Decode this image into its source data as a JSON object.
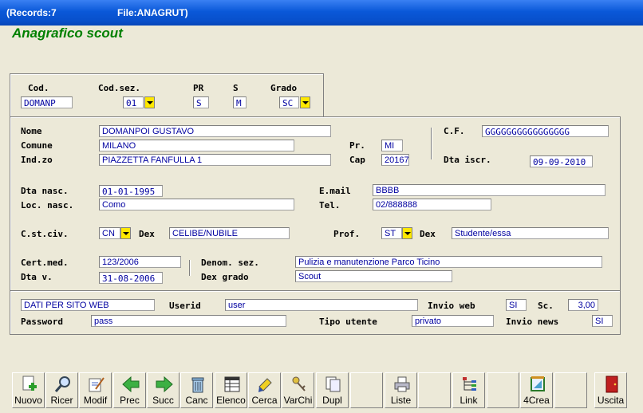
{
  "window": {
    "records": "(Records:7",
    "file": "File:ANAGRUT)"
  },
  "heading": "Anagrafico scout",
  "top": {
    "cod_label": "Cod.",
    "cod": "DOMANP",
    "codsez_label": "Cod.sez.",
    "codsez": "01",
    "pr_label": "PR",
    "pr": "S",
    "s_label": "S",
    "s": "M",
    "grado_label": "Grado",
    "grado": "SC"
  },
  "anag": {
    "nome_label": "Nome",
    "nome": "DOMANPOI GUSTAVO",
    "comune_label": "Comune",
    "comune": "MILANO",
    "indzo_label": "Ind.zo",
    "indzo": "PIAZZETTA FANFULLA 1",
    "pr_label": "Pr.",
    "pr": "MI",
    "cap_label": "Cap",
    "cap": "20167",
    "cf_label": "C.F.",
    "cf": "GGGGGGGGGGGGGGGG",
    "dtaiscr_label": "Dta iscr.",
    "dtaiscr": "09-09-2010",
    "dtanasc_label": "Dta nasc.",
    "dtanasc": "01-01-1995",
    "locnasc_label": "Loc. nasc.",
    "locnasc": "Como",
    "email_label": "E.mail",
    "email": "BBBB",
    "tel_label": "Tel.",
    "tel": "02/888888",
    "cstciv_label": "C.st.civ.",
    "cstciv": "CN",
    "dex1_label": "Dex",
    "dex1": "CELIBE/NUBILE",
    "prof_label": "Prof.",
    "prof": "ST",
    "dex2_label": "Dex",
    "dex2": "Studente/essa",
    "certmed_label": "Cert.med.",
    "certmed": "123/2006",
    "dtav_label": "Dta v.",
    "dtav": "31-08-2006",
    "denomsez_label": "Denom. sez.",
    "denomsez": "Pulizia e manutenzione Parco Ticino",
    "dexgrado_label": "Dex grado",
    "dexgrado": "Scout"
  },
  "web": {
    "title": "DATI PER SITO WEB",
    "userid_label": "Userid",
    "userid": "user",
    "invioweb_label": "Invio web",
    "invioweb": "SI",
    "sc_label": "Sc.",
    "sc": "3,00",
    "password_label": "Password",
    "password": "pass",
    "tipoutente_label": "Tipo utente",
    "tipoutente": "privato",
    "invionews_label": "Invio news",
    "invionews": "SI"
  },
  "toolbar": {
    "nuovo": "Nuovo",
    "ricer": "Ricer",
    "modif": "Modif",
    "prec": "Prec",
    "succ": "Succ",
    "canc": "Canc",
    "elenco": "Elenco",
    "cerca": "Cerca",
    "varchi": "VarChi",
    "dupl": "Dupl",
    "liste": "Liste",
    "link": "Link",
    "crea": "4Crea",
    "uscita": "Uscita"
  }
}
